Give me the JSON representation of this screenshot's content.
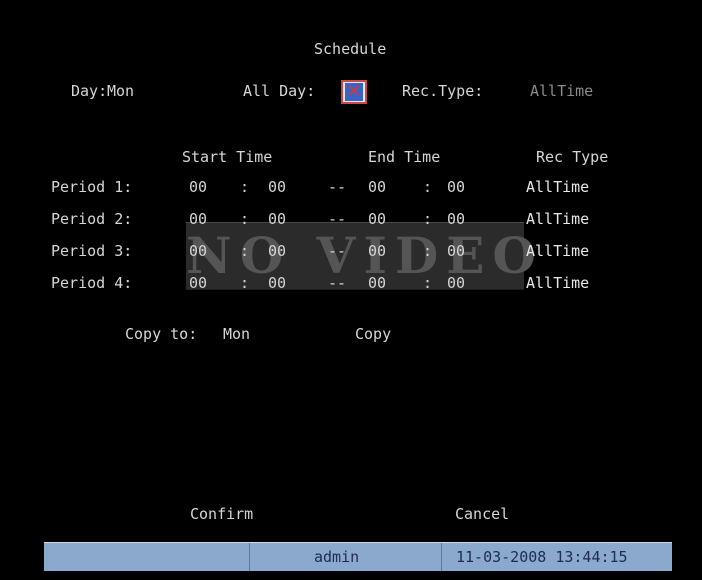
{
  "title": "Schedule",
  "day": {
    "label": "Day:",
    "value": "Mon"
  },
  "all_day": {
    "label": "All Day:",
    "checked": true
  },
  "rec_type": {
    "label": "Rec.Type:",
    "value": "AllTime"
  },
  "headers": {
    "start": "Start Time",
    "end": "End Time",
    "rec": "Rec Type"
  },
  "periods": [
    {
      "label": "Period 1:",
      "sh": "00",
      "sm": "00",
      "eh": "00",
      "em": "00",
      "type": "AllTime"
    },
    {
      "label": "Period 2:",
      "sh": "00",
      "sm": "00",
      "eh": "00",
      "em": "00",
      "type": "AllTime"
    },
    {
      "label": "Period 3:",
      "sh": "00",
      "sm": "00",
      "eh": "00",
      "em": "00",
      "type": "AllTime"
    },
    {
      "label": "Period 4:",
      "sh": "00",
      "sm": "00",
      "eh": "00",
      "em": "00",
      "type": "AllTime"
    }
  ],
  "separators": {
    "colon": ":",
    "dash": "--"
  },
  "copy": {
    "label": "Copy to:",
    "value": "Mon",
    "button": "Copy"
  },
  "buttons": {
    "confirm": "Confirm",
    "cancel": "Cancel"
  },
  "watermark": "NO VIDEO",
  "status": {
    "user": "admin",
    "datetime": "11-03-2008 13:44:15"
  },
  "colors": {
    "background": "#000000",
    "text": "#d6d6d6",
    "status_bar": "#8aa9cd",
    "checkbox_mark": "#d23a3a"
  }
}
